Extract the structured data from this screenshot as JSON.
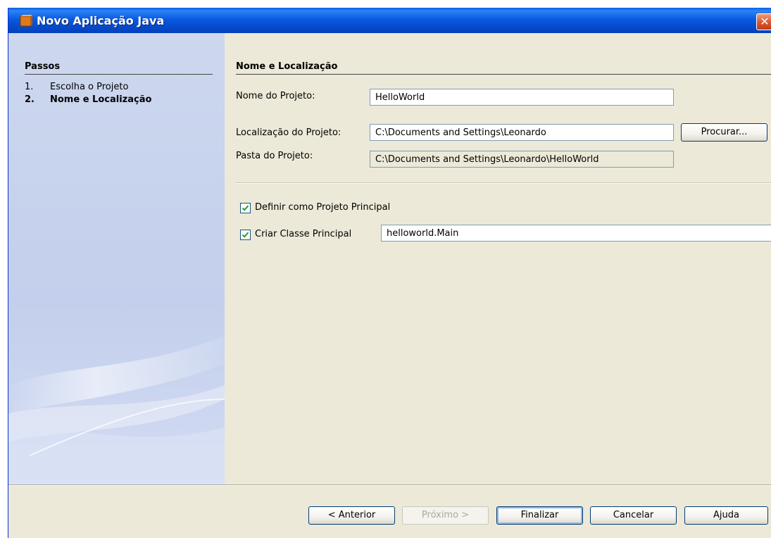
{
  "window": {
    "title": "Novo Aplicação Java",
    "close_glyph": "✕"
  },
  "sidebar": {
    "title": "Passos",
    "steps": [
      {
        "num": "1.",
        "label": "Escolha o Projeto"
      },
      {
        "num": "2.",
        "label": "Nome e Localização"
      }
    ]
  },
  "main": {
    "section_title": "Nome e Localização",
    "project_name_label": "Nome do Projeto:",
    "project_name_value": "HelloWorld",
    "project_location_label": "Localização do Projeto:",
    "project_location_value": "C:\\Documents and Settings\\Leonardo",
    "browse_button": "Procurar...",
    "project_folder_label": "Pasta do Projeto:",
    "project_folder_value": "C:\\Documents and Settings\\Leonardo\\HelloWorld",
    "set_main_project_label": "Definir como Projeto Principal",
    "set_main_project_checked": true,
    "create_main_class_label": "Criar Classe Principal",
    "create_main_class_checked": true,
    "main_class_value": "helloworld.Main"
  },
  "footer": {
    "back_button": "< Anterior",
    "next_button": "Próximo >",
    "finish_button": "Finalizar",
    "cancel_button": "Cancelar",
    "help_button": "Ajuda"
  }
}
